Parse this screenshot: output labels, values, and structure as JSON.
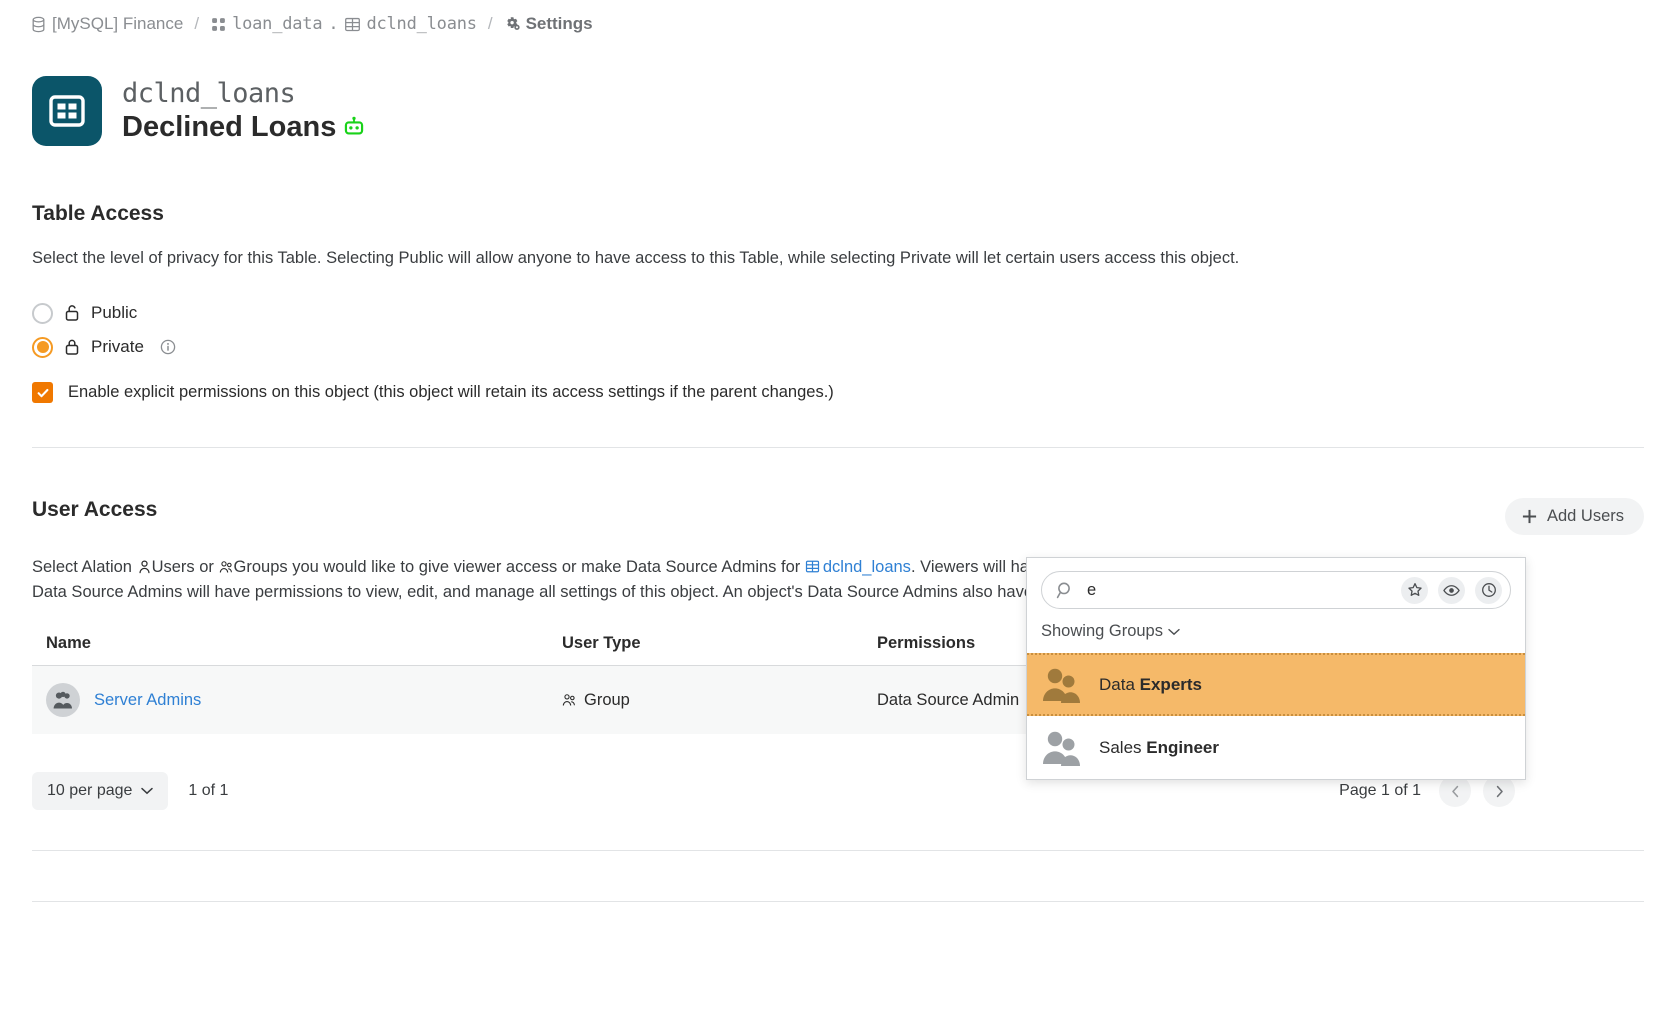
{
  "breadcrumb": {
    "datasource": "[MySQL] Finance",
    "schema": "loan_data",
    "dot": ".",
    "table": "dclnd_loans",
    "settings": "Settings",
    "sep": "/"
  },
  "header": {
    "object_id": "dclnd_loans",
    "title": "Declined Loans",
    "table_icon": "table-icon",
    "ai_badge_icon": "robot-icon"
  },
  "table_access": {
    "heading": "Table Access",
    "description": "Select the level of privacy for this Table. Selecting Public will allow anyone to have access to this Table, while selecting Private will let certain users access this object.",
    "options": [
      {
        "label": "Public",
        "icon": "unlock-icon",
        "selected": false
      },
      {
        "label": "Private",
        "icon": "lock-icon",
        "selected": true,
        "info_icon": "info-icon"
      }
    ],
    "explicit_permissions": {
      "label": "Enable explicit permissions on this object (this object will retain its access settings if the parent changes.)",
      "checked": true
    }
  },
  "user_access": {
    "heading": "User Access",
    "description_part1": "Select Alation ",
    "users_word": "Users",
    "description_part2": " or ",
    "groups_word": "Groups",
    "description_part3": " you would like to give viewer access or make Data Source Admins for ",
    "object_link": "dclnd_loans",
    "description_part4": ". Viewers will have permissions to view this object in the Alation Catalog, while Data Source Admins will have permissions to view, edit, and manage all settings of this object. An object's Data Source Admins also have the permissions to use their own credentials to query this object.",
    "add_users_label": "Add Users",
    "columns": [
      "Name",
      "User Type",
      "Permissions",
      ""
    ],
    "rows": [
      {
        "name": "Server Admins",
        "user_type": "Group",
        "permissions": "Data Source Admin",
        "action": ""
      }
    ]
  },
  "pagination": {
    "per_page": "10 per page",
    "range": "1 of 1",
    "page_label": "Page 1 of 1",
    "prev_icon": "chevron-left-icon",
    "next_icon": "chevron-right-icon"
  },
  "dropdown": {
    "search_value": "e",
    "search_placeholder": "",
    "search_icon": "search-icon",
    "actions": [
      {
        "icon": "star-icon",
        "name": "favorites-filter"
      },
      {
        "icon": "eye-icon",
        "name": "watched-filter"
      },
      {
        "icon": "clock-icon",
        "name": "recent-filter"
      }
    ],
    "showing_label": "Showing Groups",
    "items": [
      {
        "prefix": "Data ",
        "match": "Experts",
        "active": true
      },
      {
        "prefix": "Sales ",
        "match": "Engineer",
        "active": false
      }
    ]
  },
  "colors": {
    "accent_orange": "#f07800",
    "radio_orange": "#f59a23",
    "highlight_orange": "#f5b969",
    "link_blue": "#2f80d4",
    "badge_teal": "#0b5569",
    "robot_green": "#19d219"
  }
}
